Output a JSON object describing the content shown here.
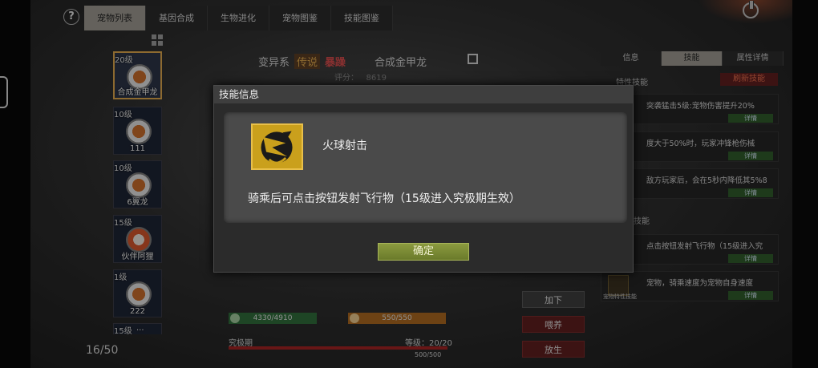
{
  "tabs": [
    {
      "label": "宠物列表",
      "active": true
    },
    {
      "label": "基因合成"
    },
    {
      "label": "生物进化"
    },
    {
      "label": "宠物图鉴"
    },
    {
      "label": "技能图鉴"
    }
  ],
  "help_label": "?",
  "pets": [
    {
      "level": "20级",
      "name": "合成金甲龙",
      "selected": true
    },
    {
      "level": "10级",
      "name": "111"
    },
    {
      "level": "10级",
      "name": "6翼龙"
    },
    {
      "level": "15级",
      "name": "伙伴阿狸"
    },
    {
      "level": "1级",
      "name": "222"
    },
    {
      "level": "15级",
      "name": "..."
    }
  ],
  "pet_count": "16/50",
  "pet_header": {
    "type": "变异系",
    "rarity": "传说",
    "trait": "暴躁",
    "name": "合成金甲龙",
    "score_label": "评分：",
    "score_value": "8619"
  },
  "stats": {
    "health": "4330/4910",
    "stamina": "550/550",
    "stage": "究极期",
    "level_label": "等级：",
    "level_value": "20/20",
    "xp": "500/500"
  },
  "actions": {
    "add": "加下",
    "feed": "喂养",
    "release": "放生"
  },
  "right_panel": {
    "tabs": [
      {
        "label": "信息"
      },
      {
        "label": "技能",
        "active": true
      },
      {
        "label": "属性详情"
      }
    ],
    "section_traits": "特性技能",
    "refresh": "刷新技能",
    "section_skills": "技能",
    "detail_label": "详情",
    "rows": [
      {
        "text": "突袭猛击5级:宠物伤害提升20%",
        "label": ""
      },
      {
        "text": "度大于50%时，玩家冲锋枪伤械",
        "label": ""
      },
      {
        "text": "敌方玩家后，会在5秒内降低其5%8",
        "label": ""
      },
      {
        "text": "点击按钮发射飞行物（15级进入究",
        "label": "技能"
      },
      {
        "text": "宠物，骑乘速度为宠物自身速度",
        "label": "宠物特性技能"
      }
    ]
  },
  "dialog": {
    "title": "技能信息",
    "skill_name": "火球射击",
    "description": "骑乘后可点击按钮发射飞行物（15级进入究极期生效）",
    "confirm": "确定"
  }
}
